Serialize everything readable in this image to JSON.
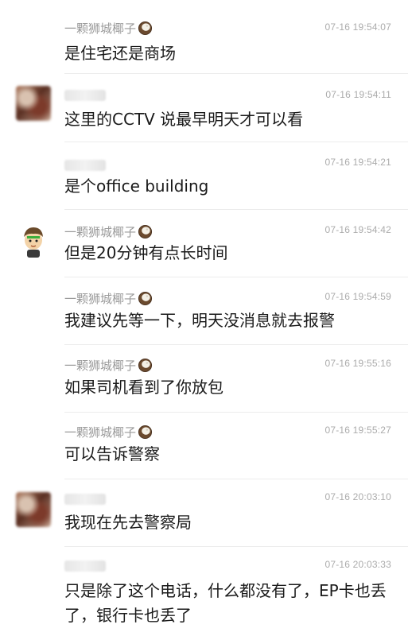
{
  "messages": [
    {
      "sender": "一颗狮城椰子",
      "sender_visible": true,
      "time": "07-16 19:54:07",
      "text": "是住宅还是商场",
      "avatar": "none"
    },
    {
      "sender": "",
      "sender_visible": false,
      "time": "07-16 19:54:11",
      "text": "这里的CCTV 说最早明天才可以看",
      "avatar": "blurred-photo"
    },
    {
      "sender": "",
      "sender_visible": false,
      "time": "07-16 19:54:21",
      "text": "是个office building",
      "avatar": "none"
    },
    {
      "sender": "一颗狮城椰子",
      "sender_visible": true,
      "time": "07-16 19:54:42",
      "text": "但是20分钟有点长时间",
      "avatar": "cartoon"
    },
    {
      "sender": "一颗狮城椰子",
      "sender_visible": true,
      "time": "07-16 19:54:59",
      "text": "我建议先等一下，明天没消息就去报警",
      "avatar": "none"
    },
    {
      "sender": "一颗狮城椰子",
      "sender_visible": true,
      "time": "07-16 19:55:16",
      "text": "如果司机看到了你放包",
      "avatar": "none"
    },
    {
      "sender": "一颗狮城椰子",
      "sender_visible": true,
      "time": "07-16 19:55:27",
      "text": "可以告诉警察",
      "avatar": "none"
    },
    {
      "sender": "",
      "sender_visible": false,
      "time": "07-16 20:03:10",
      "text": "我现在先去警察局",
      "avatar": "blurred-photo"
    },
    {
      "sender": "",
      "sender_visible": false,
      "time": "07-16 20:03:33",
      "text": "只是除了这个电话，什么都没有了，EP卡也丢了，银行卡也丢了",
      "avatar": "none"
    }
  ],
  "icons": {
    "badge": "coconut-icon"
  },
  "colors": {
    "sender": "#9a9a9a",
    "time": "#ababab",
    "text": "#1a1a1a",
    "divider": "#ececec"
  }
}
